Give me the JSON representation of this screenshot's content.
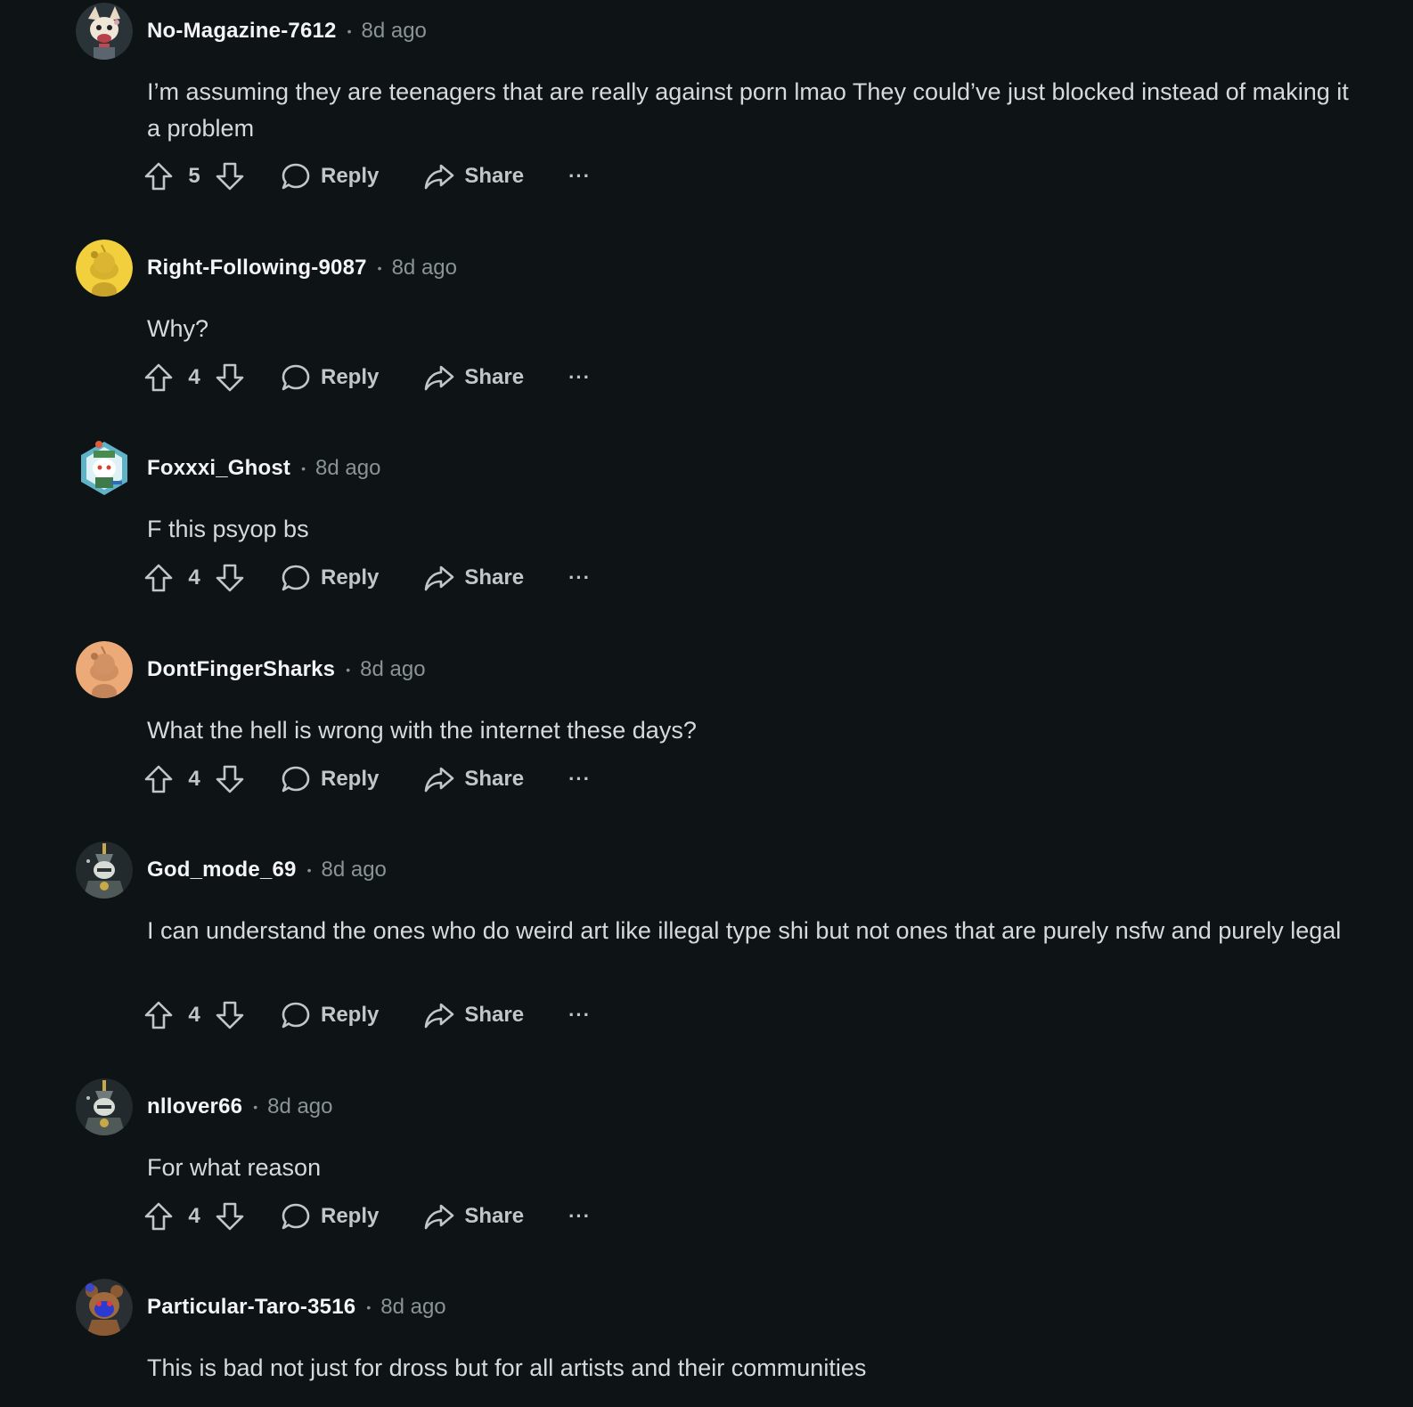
{
  "comments": [
    {
      "username": "No-Magazine-7612",
      "time": "8d ago",
      "text": "I’m assuming they are teenagers that are really against porn lmao  They could’ve just blocked instead of making it a problem",
      "votes": "5",
      "avatar": "fox-avatar"
    },
    {
      "username": "Right-Following-9087",
      "time": "8d ago",
      "text": "Why?",
      "votes": "4",
      "avatar": "snoo-yellow-avatar"
    },
    {
      "username": "Foxxxi_Ghost",
      "time": "8d ago",
      "text": "F this psyop bs",
      "votes": "4",
      "avatar": "hexagon-snoo-avatar"
    },
    {
      "username": "DontFingerSharks",
      "time": "8d ago",
      "text": "What the hell is wrong with the internet these days?",
      "votes": "4",
      "avatar": "snoo-orange-avatar"
    },
    {
      "username": "God_mode_69",
      "time": "8d ago",
      "text": "I can understand the ones who do weird art like illegal type shi but not ones that are purely nsfw and purely legal",
      "votes": "4",
      "avatar": "armored-avatar"
    },
    {
      "username": "nllover66",
      "time": "8d ago",
      "text": "For what reason",
      "votes": "4",
      "avatar": "armored-avatar"
    },
    {
      "username": "Particular-Taro-3516",
      "time": "8d ago",
      "text": "This is bad not just for dross but for all artists and their communities",
      "votes": "",
      "avatar": "bear-avatar"
    }
  ],
  "labels": {
    "reply": "Reply",
    "share": "Share",
    "dot": "•",
    "more": "···"
  },
  "colors": {
    "background": "#0e1316",
    "username": "#f2f4f5",
    "muted": "#8a9396",
    "body_text": "#d7dadc"
  }
}
